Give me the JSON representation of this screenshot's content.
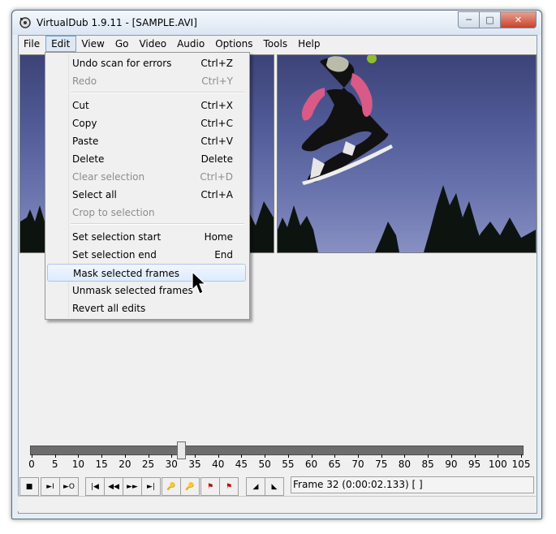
{
  "window": {
    "title": "VirtualDub 1.9.11 - [SAMPLE.AVI]"
  },
  "menubar": [
    "File",
    "Edit",
    "View",
    "Go",
    "Video",
    "Audio",
    "Options",
    "Tools",
    "Help"
  ],
  "edit_menu": {
    "items": [
      {
        "label": "Undo scan for errors",
        "shortcut": "Ctrl+Z",
        "enabled": true
      },
      {
        "label": "Redo",
        "shortcut": "Ctrl+Y",
        "enabled": false
      },
      {
        "label": "Cut",
        "shortcut": "Ctrl+X",
        "enabled": true
      },
      {
        "label": "Copy",
        "shortcut": "Ctrl+C",
        "enabled": true
      },
      {
        "label": "Paste",
        "shortcut": "Ctrl+V",
        "enabled": true
      },
      {
        "label": "Delete",
        "shortcut": "Delete",
        "enabled": true
      },
      {
        "label": "Clear selection",
        "shortcut": "Ctrl+D",
        "enabled": false
      },
      {
        "label": "Select all",
        "shortcut": "Ctrl+A",
        "enabled": true
      },
      {
        "label": "Crop to selection",
        "shortcut": "",
        "enabled": false
      },
      {
        "label": "Set selection start",
        "shortcut": "Home",
        "enabled": true
      },
      {
        "label": "Set selection end",
        "shortcut": "End",
        "enabled": true
      },
      {
        "label": "Mask selected frames",
        "shortcut": "",
        "enabled": true,
        "highlighted": true
      },
      {
        "label": "Unmask selected frames",
        "shortcut": "",
        "enabled": true
      },
      {
        "label": "Revert all edits",
        "shortcut": "",
        "enabled": true
      }
    ]
  },
  "timeline": {
    "ticks": [
      "0",
      "5",
      "10",
      "15",
      "20",
      "25",
      "30",
      "35",
      "40",
      "45",
      "50",
      "55",
      "60",
      "65",
      "70",
      "75",
      "80",
      "85",
      "90",
      "95",
      "100",
      "105"
    ],
    "current_frame": 32,
    "max_frame": 105
  },
  "status": {
    "frame_text": "Frame 32 (0:00:02.133) [ ]"
  },
  "colors": {
    "accent": "#3399ff",
    "highlight_border": "#a8c8ea",
    "close_button": "#c8432b"
  }
}
